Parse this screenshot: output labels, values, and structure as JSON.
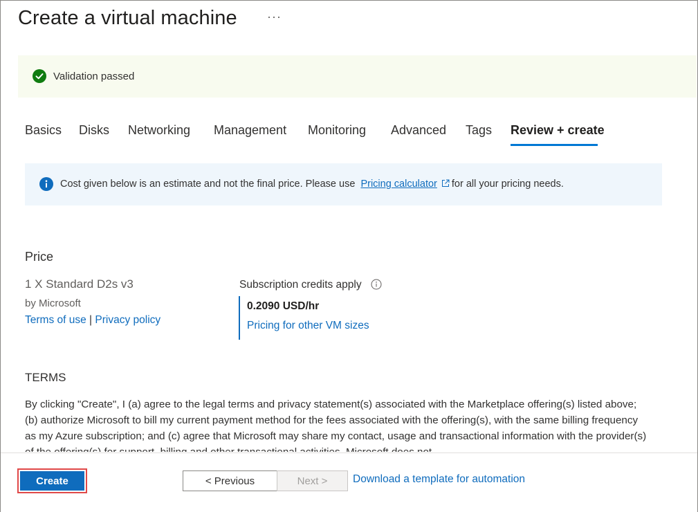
{
  "page": {
    "title": "Create a virtual machine",
    "more": "···"
  },
  "validation": {
    "message": "Validation passed",
    "color": "#107c10"
  },
  "tabs": [
    {
      "label": "Basics"
    },
    {
      "label": "Disks"
    },
    {
      "label": "Networking"
    },
    {
      "label": "Management"
    },
    {
      "label": "Monitoring"
    },
    {
      "label": "Advanced"
    },
    {
      "label": "Tags"
    },
    {
      "label": "Review + create",
      "active": true
    }
  ],
  "info": {
    "text_before": "Cost given below is an estimate and not the final price. Please use",
    "link_label": "Pricing calculator",
    "text_after": "for all your pricing needs."
  },
  "price": {
    "heading": "Price",
    "product": "1 X Standard D2s v3",
    "publisher": "by Microsoft",
    "terms_link": "Terms of use",
    "separator": "|",
    "privacy_link": "Privacy policy",
    "credits_label": "Subscription credits apply",
    "rate": "0.2090 USD/hr",
    "other_sizes_link": "Pricing for other VM sizes"
  },
  "terms": {
    "heading": "TERMS",
    "body": "By clicking \"Create\", I (a) agree to the legal terms and privacy statement(s) associated with the Marketplace offering(s) listed above; (b) authorize Microsoft to bill my current payment method for the fees associated with the offering(s), with the same billing frequency as my Azure subscription; and (c) agree that Microsoft may share my contact, usage and transactional information with the provider(s) of the offering(s) for support, billing and other transactional activities. Microsoft does not"
  },
  "footer": {
    "create_label": "Create",
    "previous_label": "< Previous",
    "next_label": "Next >",
    "download_link": "Download a template for automation"
  },
  "colors": {
    "accent": "#0f6cbd",
    "success": "#107c10",
    "highlight_border": "#e04848"
  }
}
